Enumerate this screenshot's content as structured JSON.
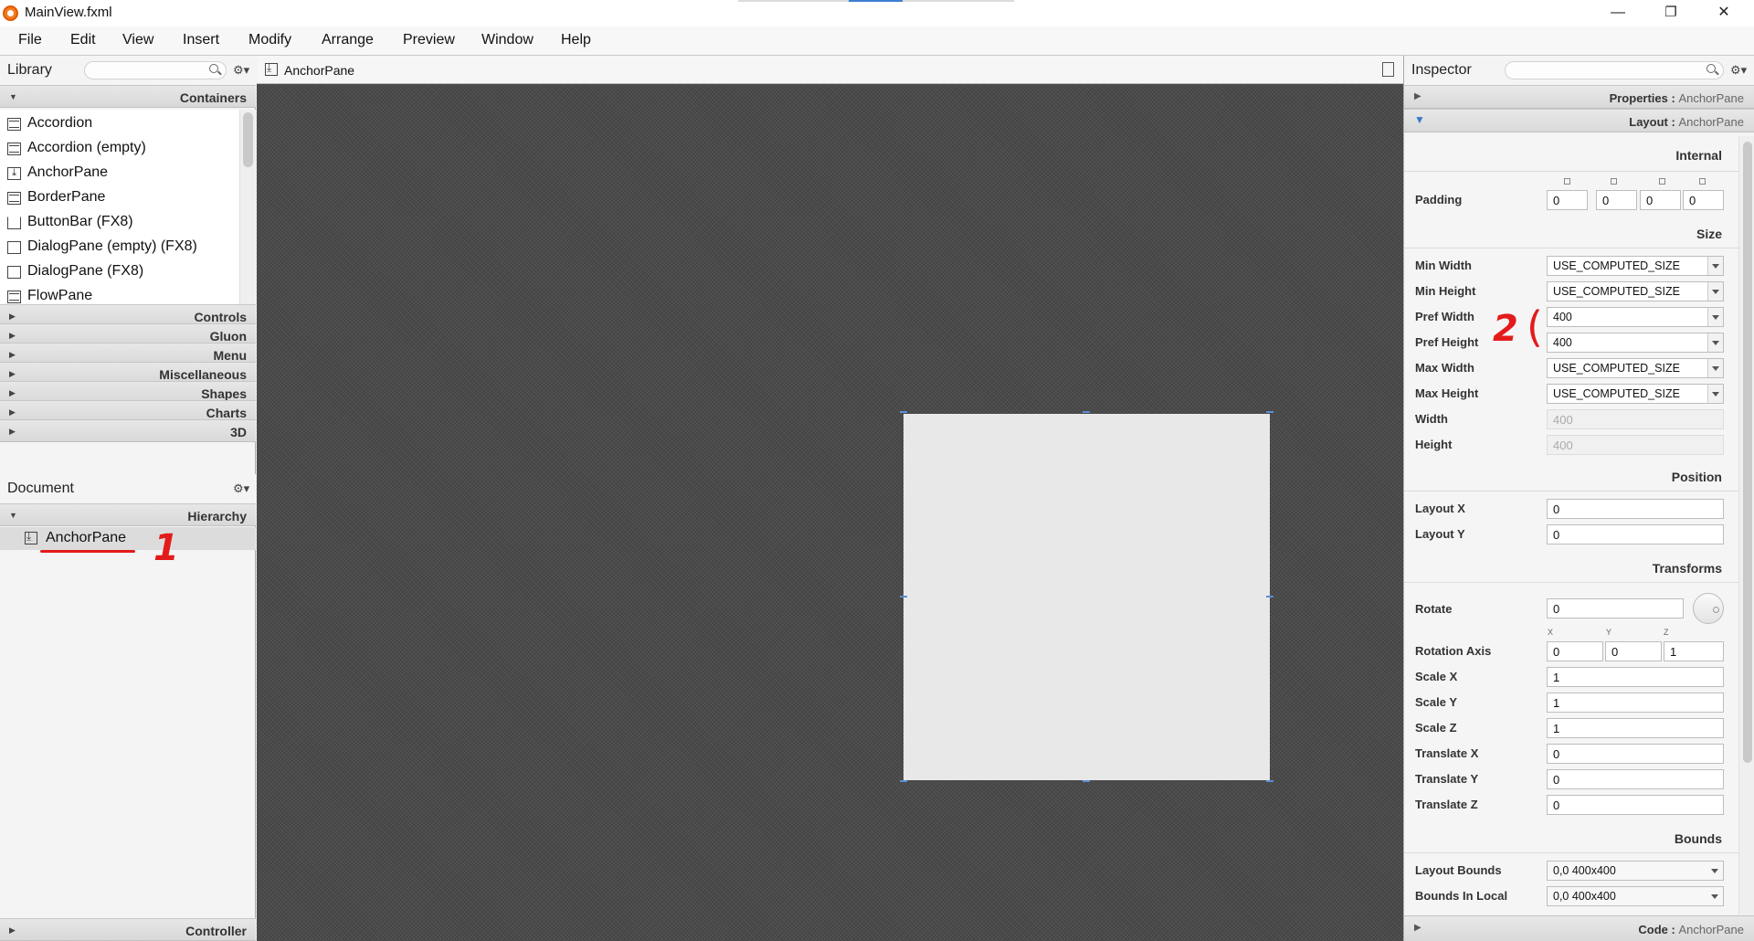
{
  "window": {
    "title": "MainView.fxml",
    "minimize": "—",
    "maximize": "❐",
    "close": "✕"
  },
  "menu": [
    "File",
    "Edit",
    "View",
    "Insert",
    "Modify",
    "Arrange",
    "Preview",
    "Window",
    "Help"
  ],
  "library": {
    "title": "Library",
    "sections_open": "Containers",
    "items": [
      "Accordion",
      "Accordion  (empty)",
      "AnchorPane",
      "BorderPane",
      "ButtonBar  (FX8)",
      "DialogPane (empty)  (FX8)",
      "DialogPane  (FX8)",
      "FlowPane"
    ],
    "sections_closed": [
      "Controls",
      "Gluon",
      "Menu",
      "Miscellaneous",
      "Shapes",
      "Charts",
      "3D"
    ]
  },
  "document": {
    "title": "Document",
    "section": "Hierarchy",
    "tree_item": "AnchorPane",
    "controller": "Controller"
  },
  "center": {
    "breadcrumb": "AnchorPane"
  },
  "annotations": {
    "one": "1",
    "two": "2"
  },
  "inspector": {
    "title": "Inspector",
    "properties_label": "Properties : ",
    "layout_label": "Layout : ",
    "code_label": "Code : ",
    "node": "AnchorPane",
    "groups": {
      "internal": "Internal",
      "size": "Size",
      "position": "Position",
      "transforms": "Transforms",
      "bounds": "Bounds"
    },
    "padding": {
      "label": "Padding",
      "top": "0",
      "right": "0",
      "bottom": "0",
      "left": "0"
    },
    "size": {
      "min_width": {
        "label": "Min Width",
        "value": "USE_COMPUTED_SIZE"
      },
      "min_height": {
        "label": "Min Height",
        "value": "USE_COMPUTED_SIZE"
      },
      "pref_width": {
        "label": "Pref Width",
        "value": "400"
      },
      "pref_height": {
        "label": "Pref Height",
        "value": "400"
      },
      "max_width": {
        "label": "Max Width",
        "value": "USE_COMPUTED_SIZE"
      },
      "max_height": {
        "label": "Max Height",
        "value": "USE_COMPUTED_SIZE"
      },
      "width": {
        "label": "Width",
        "value": "400"
      },
      "height": {
        "label": "Height",
        "value": "400"
      }
    },
    "position": {
      "layout_x": {
        "label": "Layout X",
        "value": "0"
      },
      "layout_y": {
        "label": "Layout Y",
        "value": "0"
      }
    },
    "transforms": {
      "rotate": {
        "label": "Rotate",
        "value": "0"
      },
      "rotation_axis": {
        "label": "Rotation Axis",
        "x_label": "X",
        "y_label": "Y",
        "z_label": "Z",
        "x": "0",
        "y": "0",
        "z": "1"
      },
      "scale_x": {
        "label": "Scale X",
        "value": "1"
      },
      "scale_y": {
        "label": "Scale Y",
        "value": "1"
      },
      "scale_z": {
        "label": "Scale Z",
        "value": "1"
      },
      "translate_x": {
        "label": "Translate X",
        "value": "0"
      },
      "translate_y": {
        "label": "Translate Y",
        "value": "0"
      },
      "translate_z": {
        "label": "Translate Z",
        "value": "0"
      }
    },
    "bounds": {
      "layout_bounds": {
        "label": "Layout Bounds",
        "value": "0,0  400x400"
      },
      "bounds_in_local": {
        "label": "Bounds In Local",
        "value": "0,0  400x400"
      }
    }
  }
}
